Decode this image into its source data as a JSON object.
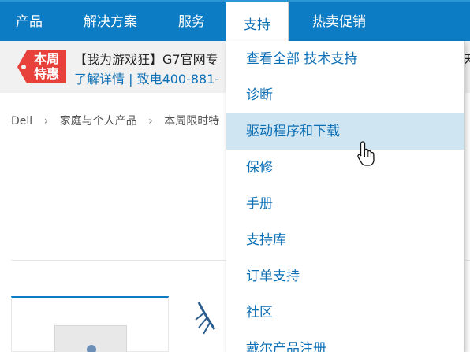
{
  "nav": {
    "items": [
      "产品",
      "解决方案",
      "服务",
      "支持",
      "热卖促销"
    ],
    "active_index": 3
  },
  "promo": {
    "tag": "本周特惠",
    "title": "【我为游戏狂】G7官网专",
    "subtitle": "了解详情 | 致电400-881-",
    "right_fragment": "天"
  },
  "breadcrumb": {
    "items": [
      "Dell",
      "家庭与个人产品",
      "本周限时特"
    ]
  },
  "dropdown": {
    "items": [
      "查看全部 技术支持",
      "诊断",
      "驱动程序和下载",
      "保修",
      "手册",
      "支持库",
      "订单支持",
      "社区",
      "戴尔产品注册"
    ],
    "hover_index": 2
  },
  "colors": {
    "nav_bg": "#0c7cc4",
    "link": "#0c6fb5",
    "hover_bg": "#cfe5f2",
    "promo_tag": "#e8403a"
  },
  "icons": {
    "cursor": "hand-pointer-icon",
    "breadcrumb_sep": "chevron-right-icon"
  }
}
